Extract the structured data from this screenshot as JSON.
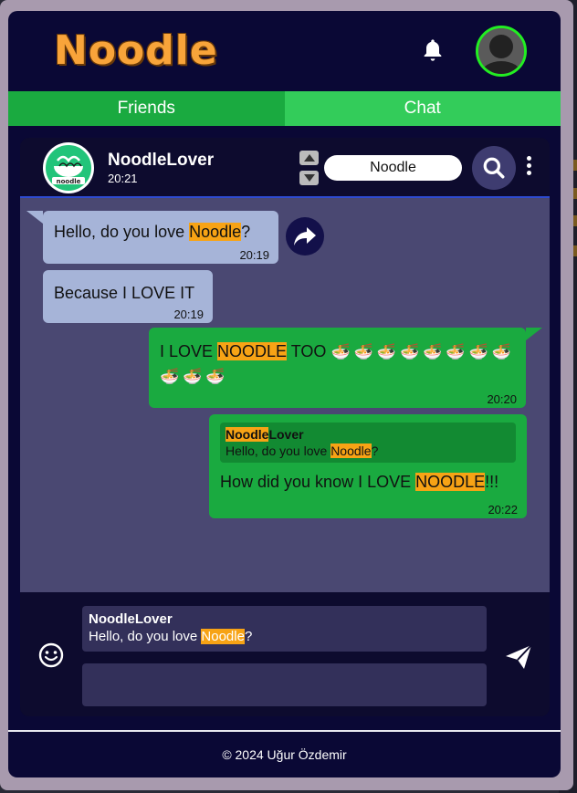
{
  "app": {
    "logo": "Noodle"
  },
  "header": {
    "bell_icon": "bell-icon",
    "avatar_icon": "user-avatar"
  },
  "tabs": [
    {
      "label": "Friends"
    },
    {
      "label": "Chat"
    }
  ],
  "chat_header": {
    "name": "NoodleLover",
    "time": "20:21",
    "search_value": "Noodle"
  },
  "messages": [
    {
      "dir": "in",
      "pre": "Hello, do you love ",
      "hl": "Noodle",
      "post": "?",
      "time": "20:19"
    },
    {
      "dir": "in",
      "text": "Because I LOVE IT",
      "time": "20:19"
    },
    {
      "dir": "out",
      "pre": "I LOVE ",
      "hl": "NOODLE",
      "post": " TOO",
      "emoji": "🍜",
      "emoji_count": 11,
      "time": "20:20"
    },
    {
      "dir": "out",
      "reply": {
        "name_hl": "Noodle",
        "name_rest": "Lover",
        "pre": "Hello, do you love ",
        "hl": "Noodle",
        "post": "?"
      },
      "pre": "How did you know I LOVE ",
      "hl": "NOODLE",
      "post": "!!!",
      "time": "20:22"
    }
  ],
  "composer": {
    "reply_name": "NoodleLover",
    "reply_pre": "Hello, do you love ",
    "reply_hl": "Noodle",
    "reply_post": "?",
    "input_value": ""
  },
  "footer": {
    "text": "© 2024 Uğur Özdemir"
  },
  "colors": {
    "highlight": "#f7a315",
    "out_bubble": "#1aaa40",
    "in_bubble": "#a6b4d8",
    "accent_green": "#22ee22"
  }
}
